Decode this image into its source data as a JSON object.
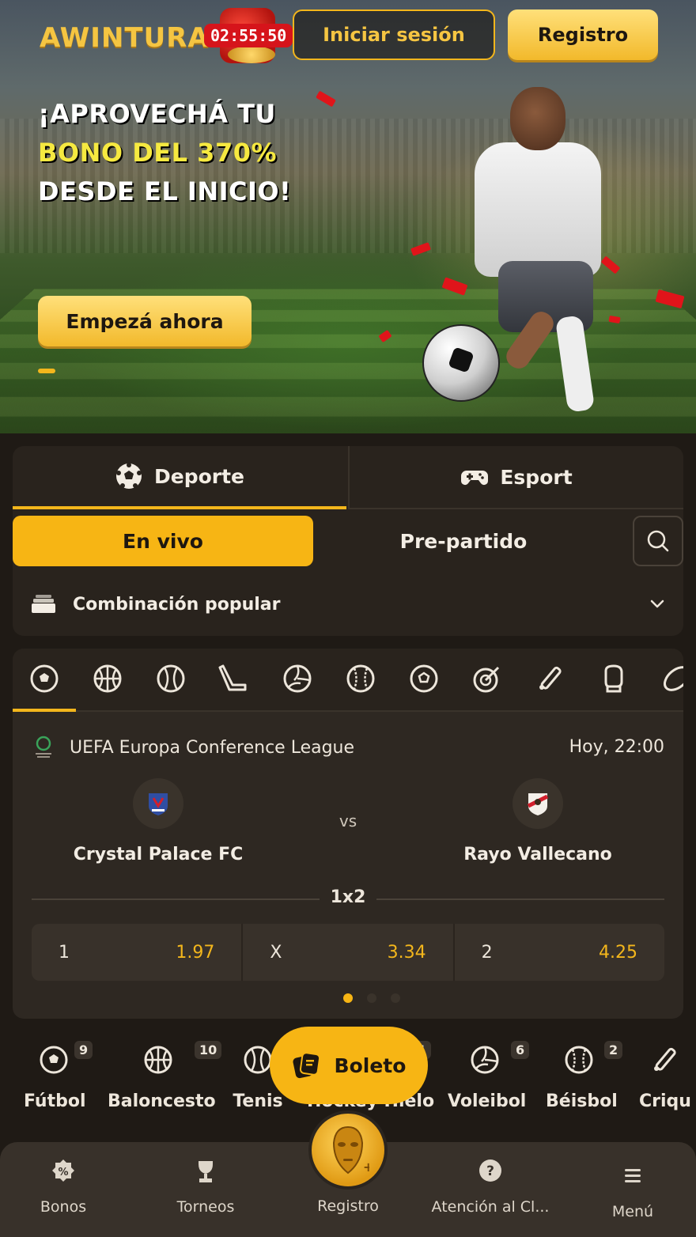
{
  "header": {
    "logo_text": "AWINTURA",
    "timer": "02:55:50",
    "login_label": "Iniciar sesión",
    "register_label": "Registro"
  },
  "hero": {
    "line1": "¡APROVECHÁ TU",
    "line2": "BONO DEL 370%",
    "line3": "DESDE EL INICIO!",
    "cta_label": "Empezá ahora"
  },
  "tabs": {
    "sport_label": "Deporte",
    "esport_label": "Esport",
    "live_label": "En vivo",
    "prematch_label": "Pre-partido",
    "combo_label": "Combinación popular"
  },
  "match": {
    "league": "UEFA Europa Conference League",
    "time": "Hoy, 22:00",
    "home": "Crystal Palace FC",
    "vs": "vs",
    "away": "Rayo Vallecano",
    "market": "1x2",
    "odds": [
      {
        "label": "1",
        "value": "1.97"
      },
      {
        "label": "X",
        "value": "3.34"
      },
      {
        "label": "2",
        "value": "4.25"
      }
    ]
  },
  "categories": [
    {
      "label": "Fútbol",
      "count": "9"
    },
    {
      "label": "Baloncesto",
      "count": "10"
    },
    {
      "label": "Tenis",
      "count": ""
    },
    {
      "label": "Hockey Hielo",
      "count": "1"
    },
    {
      "label": "Voleibol",
      "count": "6"
    },
    {
      "label": "Béisbol",
      "count": "2"
    },
    {
      "label": "Criqu",
      "count": ""
    }
  ],
  "boleto_label": "Boleto",
  "bottom_nav": {
    "bonos": "Bonos",
    "torneos": "Torneos",
    "registro": "Registro",
    "atencion": "Atención al Cl...",
    "menu": "Menú"
  },
  "colors": {
    "accent": "#f7b514",
    "background": "#1f1a15",
    "card": "#29231d",
    "odd_value": "#f3b61c"
  }
}
